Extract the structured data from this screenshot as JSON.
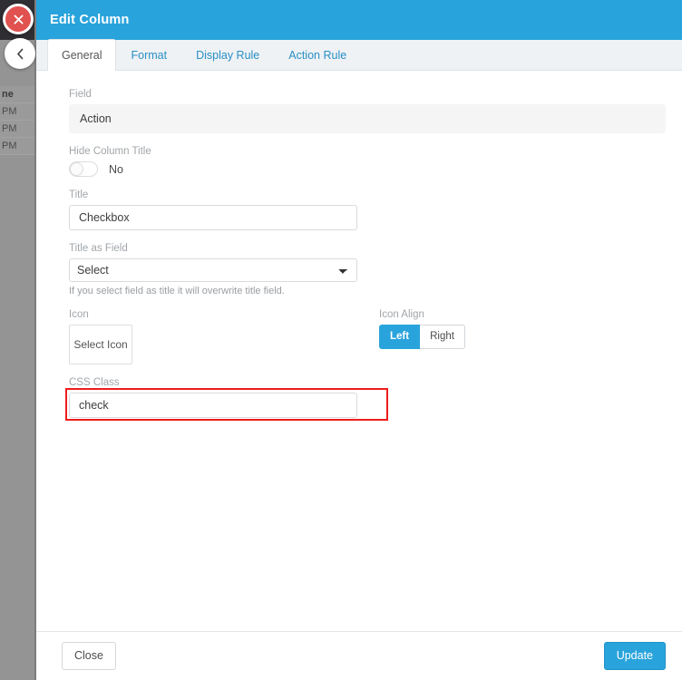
{
  "background": {
    "table_rows": [
      "ne",
      "PM",
      "PM",
      "PM"
    ]
  },
  "float_buttons": {
    "close_label": "×",
    "back_label": "‹"
  },
  "modal": {
    "title": "Edit Column",
    "header_color": "#29a3db",
    "tabs": [
      {
        "label": "General",
        "active": true
      },
      {
        "label": "Format",
        "active": false
      },
      {
        "label": "Display Rule",
        "active": false
      },
      {
        "label": "Action Rule",
        "active": false
      }
    ],
    "form": {
      "field": {
        "label": "Field",
        "value": "Action"
      },
      "hide_column_title": {
        "label": "Hide Column Title",
        "value": "No",
        "state": "off"
      },
      "title": {
        "label": "Title",
        "value": "Checkbox",
        "placeholder": ""
      },
      "title_as_field": {
        "label": "Title as Field",
        "selected": "Select",
        "options": [
          "Select"
        ],
        "help": "If you select field as title it will overwrite title field."
      },
      "icon": {
        "label": "Icon",
        "button_label": "Select Icon"
      },
      "icon_align": {
        "label": "Icon Align",
        "options": [
          "Left",
          "Right"
        ],
        "selected": "Left",
        "active_color": "#29a3db"
      },
      "css_class": {
        "label": "CSS Class",
        "value": "check",
        "placeholder": "",
        "highlight_color": "#ee1c1c"
      }
    },
    "footer": {
      "close_label": "Close",
      "update_label": "Update"
    }
  }
}
